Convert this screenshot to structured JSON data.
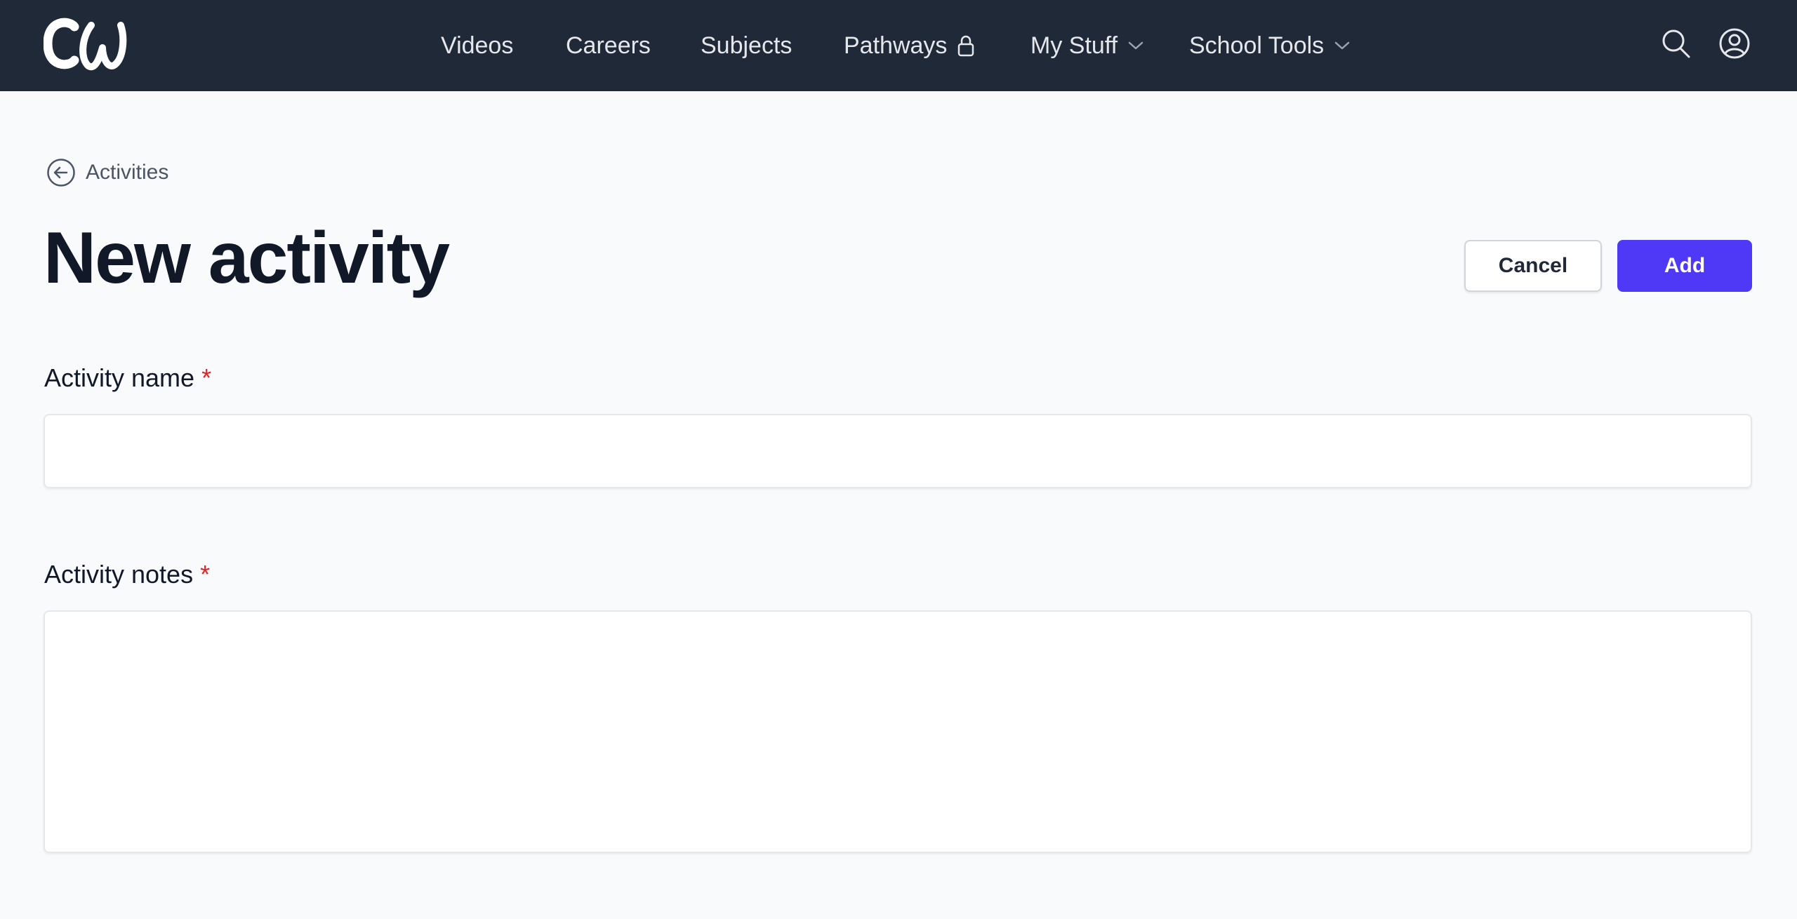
{
  "navbar": {
    "logo_text": "CW",
    "items": [
      {
        "label": "Videos"
      },
      {
        "label": "Careers"
      },
      {
        "label": "Subjects"
      },
      {
        "label": "Pathways",
        "icon": "lock-icon"
      },
      {
        "label": "My Stuff",
        "icon": "chevron-down-icon"
      },
      {
        "label": "School Tools",
        "icon": "chevron-down-icon"
      }
    ],
    "right_icons": [
      "search-icon",
      "user-circle-icon"
    ],
    "background": "#1f2937"
  },
  "breadcrumb": {
    "back_label": "Activities",
    "icon": "arrow-left-circle-icon"
  },
  "page": {
    "title": "New activity",
    "cancel_label": "Cancel",
    "add_label": "Add",
    "accent": "#4f39f6"
  },
  "form": {
    "name_label": "Activity name",
    "name_required_mark": "*",
    "name_value": "",
    "notes_label": "Activity notes",
    "notes_required_mark": "*",
    "notes_value": ""
  }
}
